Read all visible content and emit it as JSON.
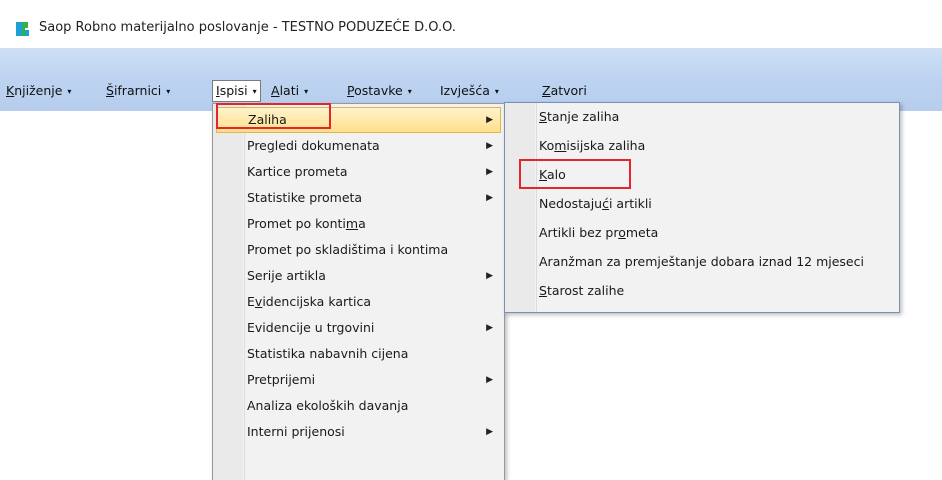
{
  "window": {
    "title": "Saop  Robno materijalno poslovanje - TESTNO PODUZEĆE D.O.O.",
    "icon": "saop-app-icon"
  },
  "menubar": {
    "items": [
      {
        "pre": "",
        "ul": "K",
        "post": "njiženje",
        "arrow": "▾"
      },
      {
        "pre": "",
        "ul": "Š",
        "post": "ifrarnici",
        "arrow": "▾"
      },
      {
        "pre": "",
        "ul": "I",
        "post": "spisi",
        "arrow": "▾"
      },
      {
        "pre": "",
        "ul": "A",
        "post": "lati",
        "arrow": "▾"
      },
      {
        "pre": "",
        "ul": "P",
        "post": "ostavke",
        "arrow": "▾"
      },
      {
        "pre": "Izvješća",
        "ul": "",
        "post": "",
        "arrow": "▾"
      },
      {
        "pre": "",
        "ul": "Z",
        "post": "atvori",
        "arrow": ""
      }
    ]
  },
  "ispisi_menu": {
    "items": [
      {
        "pre": "Zaliha",
        "ul": "",
        "post": "",
        "submenu": true
      },
      {
        "pre": "Pregledi dokumenata",
        "ul": "",
        "post": "",
        "submenu": true
      },
      {
        "pre": "Kartice prometa",
        "ul": "",
        "post": "",
        "submenu": true
      },
      {
        "pre": "Statistike prometa",
        "ul": "",
        "post": "",
        "submenu": true
      },
      {
        "pre": "Promet po konti",
        "ul": "m",
        "post": "a",
        "submenu": false
      },
      {
        "pre": "Promet po skladištima i kontima",
        "ul": "",
        "post": "",
        "submenu": false
      },
      {
        "pre": "Serije artikla",
        "ul": "",
        "post": "",
        "submenu": true
      },
      {
        "pre": "E",
        "ul": "v",
        "post": "idencijska kartica",
        "submenu": false
      },
      {
        "pre": "Evidencije u trgovini",
        "ul": "",
        "post": "",
        "submenu": true
      },
      {
        "pre": "Statistika nabavnih cijena",
        "ul": "",
        "post": "",
        "submenu": false
      },
      {
        "pre": "Pretprijemi",
        "ul": "",
        "post": "",
        "submenu": true
      },
      {
        "pre": "Analiza ekoloških davanja",
        "ul": "",
        "post": "",
        "submenu": false
      },
      {
        "pre": "Interni prijenosi",
        "ul": "",
        "post": "",
        "submenu": true
      }
    ],
    "submenu_arrow": "▶"
  },
  "zaliha_submenu": {
    "items": [
      {
        "pre": "",
        "ul": "S",
        "post": "tanje zaliha"
      },
      {
        "pre": "Ko",
        "ul": "m",
        "post": "isijska zaliha"
      },
      {
        "pre": "",
        "ul": "K",
        "post": "alo"
      },
      {
        "pre": "Nedostaju",
        "ul": "ć",
        "post": "i artikli"
      },
      {
        "pre": "Artikli bez pr",
        "ul": "o",
        "post": "meta"
      },
      {
        "pre": "Aranžman za premještanje dobara iznad 12 mjeseci",
        "ul": "",
        "post": ""
      },
      {
        "pre": "",
        "ul": "S",
        "post": "tarost zalihe"
      }
    ]
  },
  "colors": {
    "menubar_bg": "#c2d7f2",
    "highlight_bg": "#ffe49b",
    "annotation_red": "#e3262e"
  }
}
